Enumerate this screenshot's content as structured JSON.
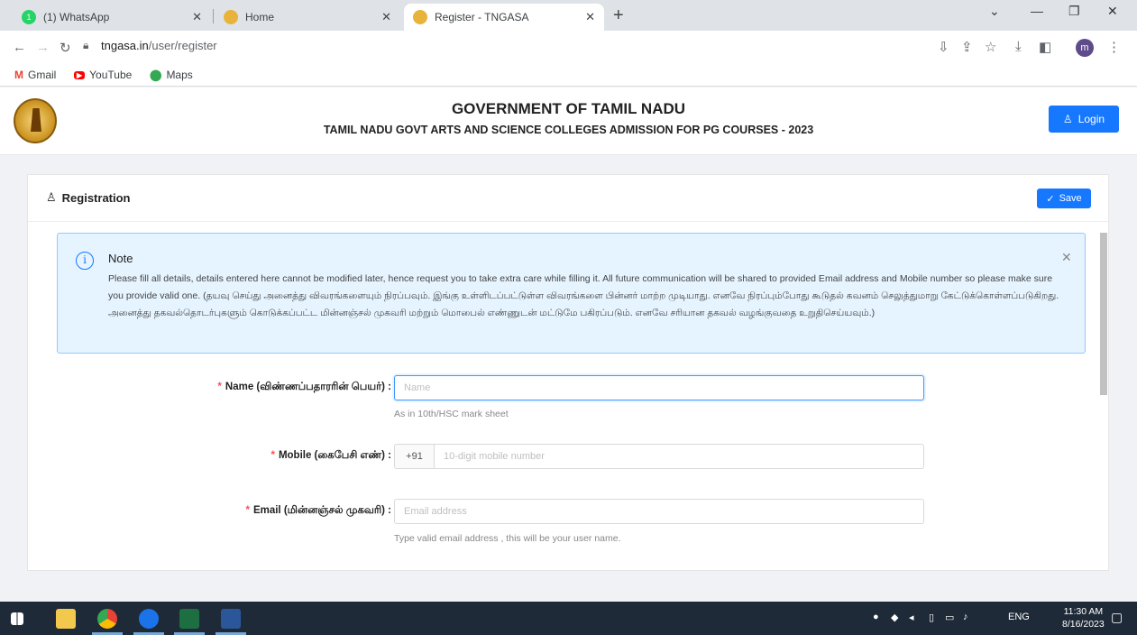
{
  "browser": {
    "tabs": [
      {
        "label": "(1) WhatsApp",
        "badge": "1"
      },
      {
        "label": "Home"
      },
      {
        "label": "Register - TNGASA"
      }
    ],
    "url_host": "tngasa.in",
    "url_path": "/user/register",
    "profile_initial": "m",
    "bookmarks": [
      {
        "label": "Gmail",
        "icon": "gmail-icon"
      },
      {
        "label": "YouTube",
        "icon": "youtube-icon"
      },
      {
        "label": "Maps",
        "icon": "maps-icon"
      }
    ]
  },
  "header": {
    "title": "GOVERNMENT OF TAMIL NADU",
    "subtitle": "TAMIL NADU GOVT ARTS AND SCIENCE COLLEGES ADMISSION FOR PG COURSES - 2023",
    "login_label": "Login"
  },
  "card": {
    "title": "Registration",
    "save_label": "Save"
  },
  "note": {
    "title": "Note",
    "body": "Please fill all details, details entered here cannot be modified later, hence request you to take extra care while filling it. All future communication will be shared to provided Email address and Mobile number so please make sure you provide valid one. (தயவு செய்து அனைத்து விவரங்களையும் நிரப்பவும். இங்கு உள்ளிடப்பட்டுள்ள விவரங்களை பின்னர் மாற்ற முடியாது. எனவே நிரப்பும்போது கூடுதல் கவனம் செலுத்துமாறு கேட்டுக்கொள்ளப்படுகிறது. அனைத்து தகவல்தொடர்புகளும் கொடுக்கப்பட்ட மின்னஞ்சல் முகவரி மற்றும் மொபைல் எண்ணுடன் மட்டுமே பகிரப்படும். எனவே சரியான தகவல் வழங்குவதை உறுதிசெய்யவும்.)"
  },
  "form": {
    "name": {
      "label": "Name (விண்ணப்பதாரரின் பெயர்) :",
      "placeholder": "Name",
      "hint": "As in 10th/HSC mark sheet"
    },
    "mobile": {
      "label": "Mobile (கைபேசி எண்) :",
      "prefix": "+91",
      "placeholder": "10-digit mobile number"
    },
    "email": {
      "label": "Email (மின்னஞ்சல் முகவரி) :",
      "placeholder": "Email address",
      "hint": "Type valid email address , this will be your user name."
    }
  },
  "taskbar": {
    "lang": "ENG",
    "time": "11:30 AM",
    "date": "8/16/2023"
  },
  "colors": {
    "primary": "#1677ff",
    "required": "#ff4d4f",
    "note_bg": "#e6f4ff"
  }
}
